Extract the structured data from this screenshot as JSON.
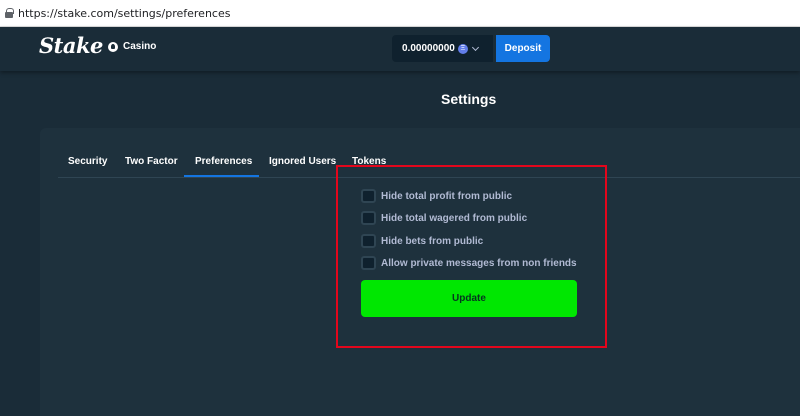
{
  "browser": {
    "url": "https://stake.com/settings/preferences"
  },
  "header": {
    "logo_text": "Stake",
    "casino_label": "Casino",
    "balance": "0.00000000",
    "currency_icon": "ethereum-icon",
    "deposit_label": "Deposit"
  },
  "page": {
    "title": "Settings"
  },
  "tabs": [
    {
      "label": "Security",
      "active": false
    },
    {
      "label": "Two Factor",
      "active": false
    },
    {
      "label": "Preferences",
      "active": true
    },
    {
      "label": "Ignored Users",
      "active": false
    },
    {
      "label": "Tokens",
      "active": false
    }
  ],
  "preferences": {
    "options": [
      {
        "label": "Hide total profit from public",
        "checked": false
      },
      {
        "label": "Hide total wagered from public",
        "checked": false
      },
      {
        "label": "Hide bets from public",
        "checked": false
      },
      {
        "label": "Allow private messages from non friends",
        "checked": false
      }
    ],
    "update_label": "Update"
  },
  "colors": {
    "background": "#1a2c38",
    "panel": "#1e313d",
    "accent": "#1475e1",
    "update_button": "#00e701",
    "highlight_box": "#e3061c"
  }
}
